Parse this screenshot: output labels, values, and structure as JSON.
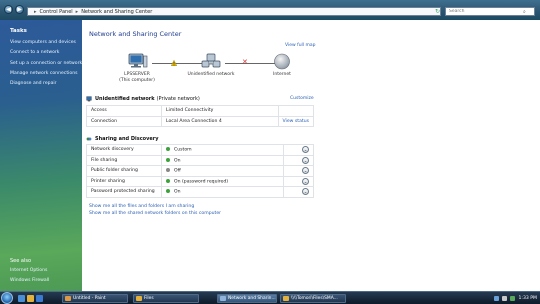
{
  "address": {
    "crumbs": [
      "Control Panel",
      "Network and Sharing Center"
    ],
    "search_placeholder": "Search"
  },
  "tasks": {
    "title": "Tasks",
    "items": [
      "View computers and devices",
      "Connect to a network",
      "Set up a connection or network",
      "Manage network connections",
      "Diagnose and repair"
    ],
    "see_also_title": "See also",
    "see_also": [
      "Internet Options",
      "Windows Firewall"
    ]
  },
  "main": {
    "title": "Network and Sharing Center",
    "view_full_map": "View full map",
    "map": {
      "computer_name": "LPSSERVER",
      "computer_sub": "(This computer)",
      "network_name": "Unidentified network",
      "internet": "Internet"
    },
    "network": {
      "name": "Unidentified network",
      "kind": "(Private network)",
      "customize": "Customize",
      "rows": [
        {
          "key": "Access",
          "value": "Limited Connectivity",
          "link": ""
        },
        {
          "key": "Connection",
          "value": "Local Area Connection 4",
          "link": "View status"
        }
      ]
    },
    "sharing": {
      "title": "Sharing and Discovery",
      "rows": [
        {
          "key": "Network discovery",
          "value": "Custom",
          "state": "on"
        },
        {
          "key": "File sharing",
          "value": "On",
          "state": "on"
        },
        {
          "key": "Public folder sharing",
          "value": "Off",
          "state": "off"
        },
        {
          "key": "Printer sharing",
          "value": "On (password required)",
          "state": "on"
        },
        {
          "key": "Password protected sharing",
          "value": "On",
          "state": "on"
        }
      ]
    },
    "bottom_links": [
      "Show me all the files and folders I am sharing",
      "Show me all the shared network folders on this computer"
    ]
  },
  "taskbar": {
    "buttons": [
      {
        "label": "Untitled - Paint",
        "active": false
      },
      {
        "label": "Files",
        "active": false
      },
      {
        "label": "Network and Sharin...",
        "active": true
      },
      {
        "label": "\\\\\\\\Tomori\\Files\\SMA...",
        "active": false
      }
    ],
    "clock": "1:33 PM"
  },
  "colors": {
    "link": "#2b5fb4",
    "title": "#1e3d8f",
    "status_on": "#3ca33c",
    "status_off": "#888888"
  },
  "icons": [
    "back-arrow-icon",
    "forward-arrow-icon",
    "refresh-icon",
    "search-icon",
    "computer-icon",
    "network-icon",
    "globe-icon",
    "warning-icon",
    "broken-link-icon",
    "chevron-down-icon",
    "windows-start-icon"
  ]
}
